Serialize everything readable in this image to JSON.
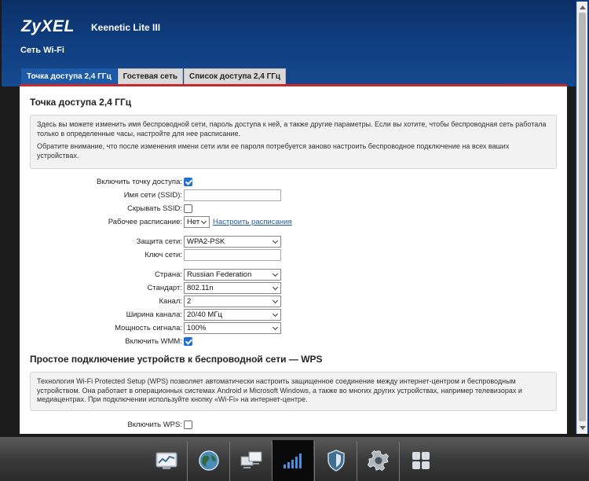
{
  "header": {
    "brand": "ZyXEL",
    "model": "Keenetic Lite III",
    "section_title": "Сеть Wi-Fi"
  },
  "tabs": [
    {
      "label": "Точка доступа 2,4 ГГц",
      "active": true
    },
    {
      "label": "Гостевая сеть",
      "active": false
    },
    {
      "label": "Список доступа 2,4 ГГц",
      "active": false
    }
  ],
  "ap": {
    "heading": "Точка доступа 2,4 ГГц",
    "info1": "Здесь вы можете изменить имя беспроводной сети, пароль доступа к ней, а также другие параметры. Если вы хотите, чтобы беспроводная сеть работала только в определенные часы, настройте для нее расписание.",
    "info2": "Обратите внимание, что после изменения имени сети или ее пароля потребуется заново настроить беспроводное подключение на всех ваших устройствах."
  },
  "form": {
    "enable_ap": {
      "label": "Включить точку доступа:",
      "checked": true
    },
    "ssid": {
      "label": "Имя сети (SSID):",
      "value": ""
    },
    "hide_ssid": {
      "label": "Скрывать SSID:",
      "checked": false
    },
    "schedule": {
      "label": "Рабочее расписание:",
      "value": "Нет",
      "link": "Настроить расписания"
    },
    "security": {
      "label": "Защита сети:",
      "value": "WPA2-PSK"
    },
    "key": {
      "label": "Ключ сети:",
      "value": ""
    },
    "country": {
      "label": "Страна:",
      "value": "Russian Federation"
    },
    "standard": {
      "label": "Стандарт:",
      "value": "802.11n"
    },
    "channel": {
      "label": "Канал:",
      "value": "2"
    },
    "width": {
      "label": "Ширина канала:",
      "value": "20/40 МГц"
    },
    "power": {
      "label": "Мощность сигнала:",
      "value": "100%"
    },
    "wmm": {
      "label": "Включить WMM:",
      "checked": true
    }
  },
  "wps": {
    "heading": "Простое подключение устройств к беспроводной сети — WPS",
    "info": "Технология Wi-Fi Protected Setup (WPS) позволяет автоматически настроить защищенное соединение между интернет-центром и беспроводным устройством. Она работает в операционных системах Android и Microsoft Windows, а также во многих других устройствах, например телевизорах и медиацентрах. При подключении используйте кнопку «Wi-Fi» на интернет-центре.",
    "enable": {
      "label": "Включить WPS:",
      "checked": false
    }
  },
  "dock": [
    {
      "icon": "monitor-chart-icon",
      "active": false
    },
    {
      "icon": "globe-icon",
      "active": false
    },
    {
      "icon": "computers-icon",
      "active": false
    },
    {
      "icon": "wifi-signal-icon",
      "active": true
    },
    {
      "icon": "shield-icon",
      "active": false
    },
    {
      "icon": "gear-icon",
      "active": false
    },
    {
      "icon": "apps-grid-icon",
      "active": false
    }
  ]
}
